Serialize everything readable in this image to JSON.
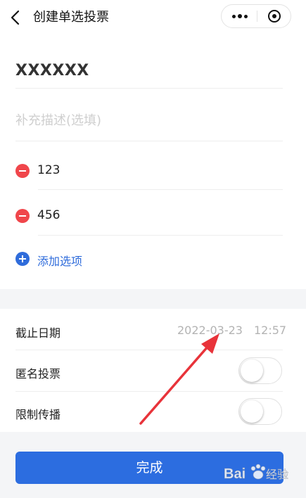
{
  "header": {
    "title": "创建单选投票"
  },
  "form": {
    "title_value": "XXXXXX",
    "description_placeholder": "补充描述(选填)",
    "options": [
      {
        "label": "123"
      },
      {
        "label": "456"
      }
    ],
    "add_option_label": "添加选项"
  },
  "settings": {
    "deadline_label": "截止日期",
    "deadline_date": "2022-03-23",
    "deadline_time": "12:57",
    "anonymous_label": "匿名投票",
    "anonymous_enabled": false,
    "restrict_label": "限制传播",
    "restrict_enabled": false
  },
  "actions": {
    "done_label": "完成"
  },
  "watermark": {
    "text": "Baidu经验"
  },
  "colors": {
    "accent": "#2c6de0",
    "delete": "#f0464b",
    "annotation_arrow": "#e8333a",
    "section_gray": "#f4f5f7"
  }
}
